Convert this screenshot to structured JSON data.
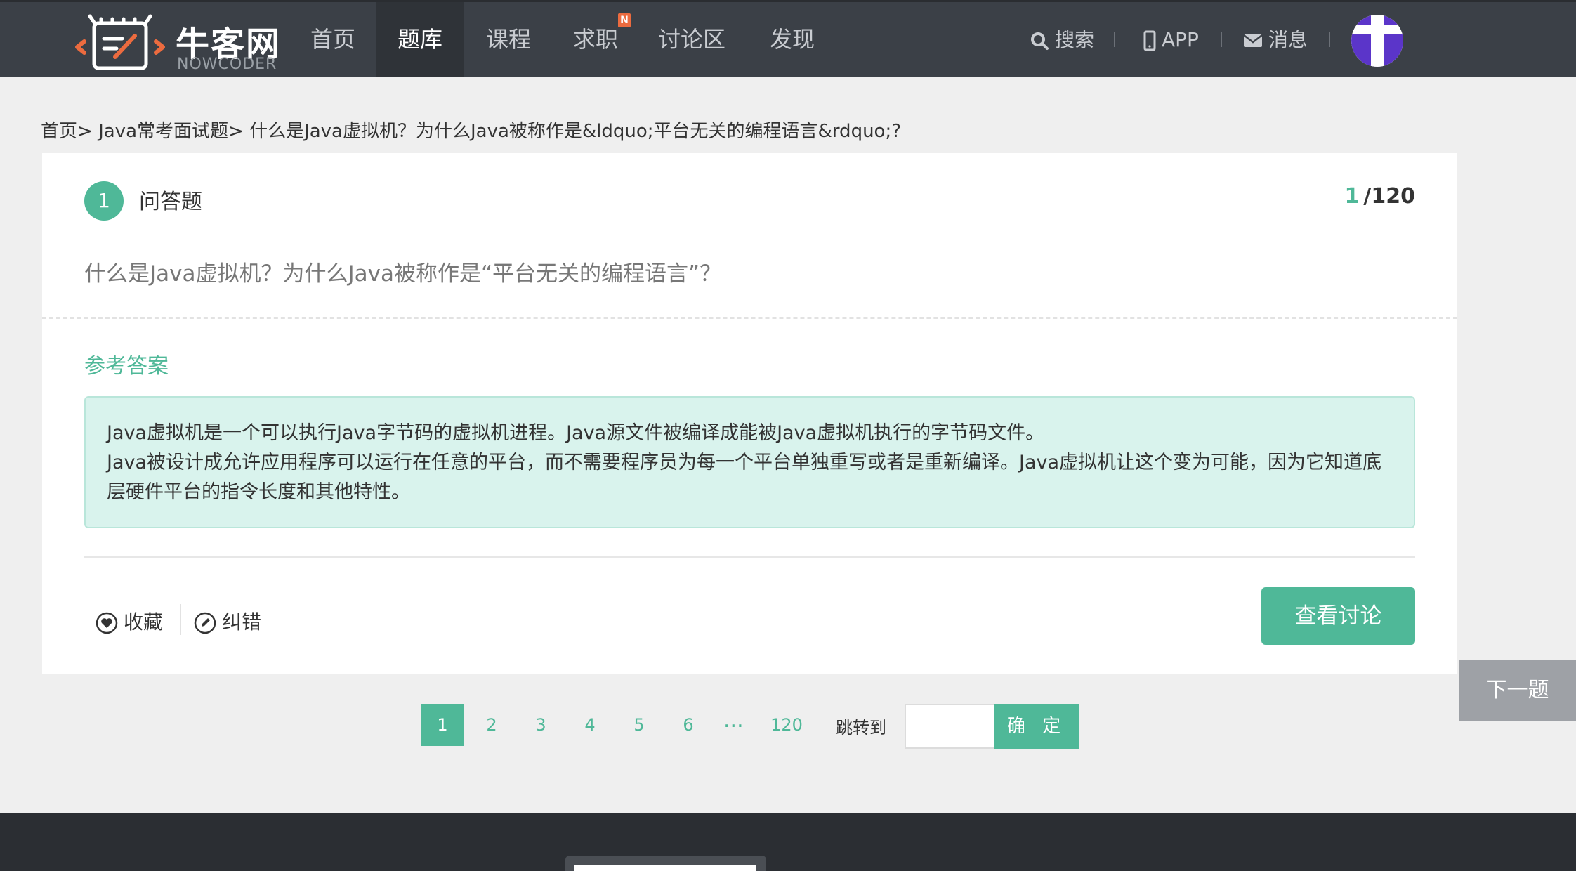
{
  "brand": {
    "name_cn": "牛客网",
    "name_en": "NOWCODER"
  },
  "nav": {
    "items": [
      {
        "label": "首页"
      },
      {
        "label": "题库",
        "active": true
      },
      {
        "label": "课程"
      },
      {
        "label": "求职",
        "badge": "N"
      },
      {
        "label": "讨论区"
      },
      {
        "label": "发现"
      }
    ],
    "right": {
      "search": "搜索",
      "app": "APP",
      "messages": "消息"
    }
  },
  "breadcrumb": {
    "home": "首页",
    "category": "Java常考面试题",
    "current": "什么是Java虚拟机？为什么Java被称作是&ldquo;平台无关的编程语言&rdquo;?"
  },
  "question": {
    "number": "1",
    "type": "问答题",
    "current": "1",
    "total": "/120",
    "text": "什么是Java虚拟机？为什么Java被称作是“平台无关的编程语言”？"
  },
  "answer": {
    "title": "参考答案",
    "line1": "Java虚拟机是一个可以执行Java字节码的虚拟机进程。Java源文件被编译成能被Java虚拟机执行的字节码文件。",
    "line2": "Java被设计成允许应用程序可以运行在任意的平台，而不需要程序员为每一个平台单独重写或者是重新编译。Java虚拟机让这个变为可能，因为它知道底层硬件平台的指令长度和其他特性。"
  },
  "actions": {
    "favorite": "收藏",
    "report": "纠错",
    "discuss": "查看讨论",
    "next": "下一题"
  },
  "pagination": {
    "pages": [
      "1",
      "2",
      "3",
      "4",
      "5",
      "6"
    ],
    "ellipsis": "...",
    "last": "120",
    "jump_label": "跳转到",
    "jump_value": "",
    "confirm": "确 定"
  },
  "colors": {
    "accent": "#4fb898",
    "nav_bg": "#3b4047",
    "answer_bg": "#d9f3ed"
  }
}
